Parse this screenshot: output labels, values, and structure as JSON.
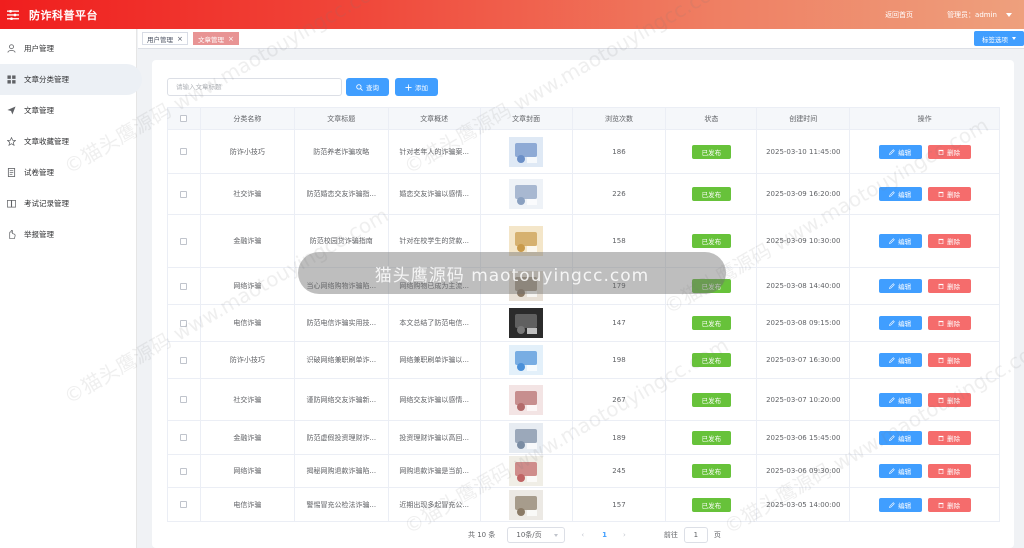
{
  "header": {
    "title": "防诈科普平台",
    "home_link": "返回首页",
    "admin_label": "管理员：admin"
  },
  "sidebar": {
    "items": [
      {
        "label": "用户管理",
        "icon": "user-icon"
      },
      {
        "label": "文章分类管理",
        "icon": "grid-icon"
      },
      {
        "label": "文章管理",
        "icon": "send-icon"
      },
      {
        "label": "文章收藏管理",
        "icon": "star-icon"
      },
      {
        "label": "试卷管理",
        "icon": "document-icon"
      },
      {
        "label": "考试记录管理",
        "icon": "book-icon"
      },
      {
        "label": "举报管理",
        "icon": "hand-icon"
      }
    ]
  },
  "tabs": [
    {
      "label": "用户管理",
      "close": "×"
    },
    {
      "label": "文章管理",
      "close": "×"
    }
  ],
  "tag_options_label": "标签选项",
  "toolbar": {
    "search_placeholder": "请输入文章标题",
    "query_label": "查询",
    "add_label": "添加"
  },
  "table": {
    "headers": [
      "分类名称",
      "文章标题",
      "文章概述",
      "文章封面",
      "浏览次数",
      "状态",
      "创建时间",
      "操作"
    ],
    "edit_label": "编辑",
    "delete_label": "删除",
    "rows": [
      {
        "category": "防诈小技巧",
        "title": "防范养老诈骗攻略",
        "summary": "针对老年人的诈骗案...",
        "views": "186",
        "status": "已发布",
        "created": "2025-03-10 11:45:00"
      },
      {
        "category": "社交诈骗",
        "title": "防范婚恋交友诈骗指...",
        "summary": "婚恋交友诈骗以感情...",
        "views": "226",
        "status": "已发布",
        "created": "2025-03-09 16:20:00"
      },
      {
        "category": "金融诈骗",
        "title": "防范校园贷诈骗指南",
        "summary": "针对在校学生的贷款...",
        "views": "158",
        "status": "已发布",
        "created": "2025-03-09 10:30:00"
      },
      {
        "category": "网络诈骗",
        "title": "当心网络购物诈骗陷...",
        "summary": "网络购物已成为主流...",
        "views": "179",
        "status": "已发布",
        "created": "2025-03-08 14:40:00"
      },
      {
        "category": "电信诈骗",
        "title": "防范电信诈骗实用技...",
        "summary": "本文总结了防范电信...",
        "views": "147",
        "status": "已发布",
        "created": "2025-03-08 09:15:00"
      },
      {
        "category": "防诈小技巧",
        "title": "识破网络兼职刷单诈...",
        "summary": "网络兼职刷单诈骗以...",
        "views": "198",
        "status": "已发布",
        "created": "2025-03-07 16:30:00"
      },
      {
        "category": "社交诈骗",
        "title": "谨防网络交友诈骗新...",
        "summary": "网络交友诈骗以感情...",
        "views": "267",
        "status": "已发布",
        "created": "2025-03-07 10:20:00"
      },
      {
        "category": "金融诈骗",
        "title": "防范虚假投资理财诈...",
        "summary": "投资理财诈骗以高回...",
        "views": "189",
        "status": "已发布",
        "created": "2025-03-06 15:45:00"
      },
      {
        "category": "网络诈骗",
        "title": "揭秘网购退款诈骗陷...",
        "summary": "网购退款诈骗是当前...",
        "views": "245",
        "status": "已发布",
        "created": "2025-03-06 09:30:00"
      },
      {
        "category": "电信诈骗",
        "title": "警惕冒充公检法诈骗...",
        "summary": "近期出现多起冒充公...",
        "views": "157",
        "status": "已发布",
        "created": "2025-03-05 14:00:00"
      }
    ]
  },
  "pagination": {
    "total": "共 10 条",
    "page_size": "10条/页",
    "prev": "‹",
    "current": "1",
    "next": "›",
    "goto_label": "前往",
    "goto_value": "1",
    "page_suffix": "页"
  },
  "watermark": {
    "band_text": "猫头鹰源码 maotouyingcc.com",
    "tile_text": "©猫头鹰源码 www.maotouyingcc.com"
  }
}
